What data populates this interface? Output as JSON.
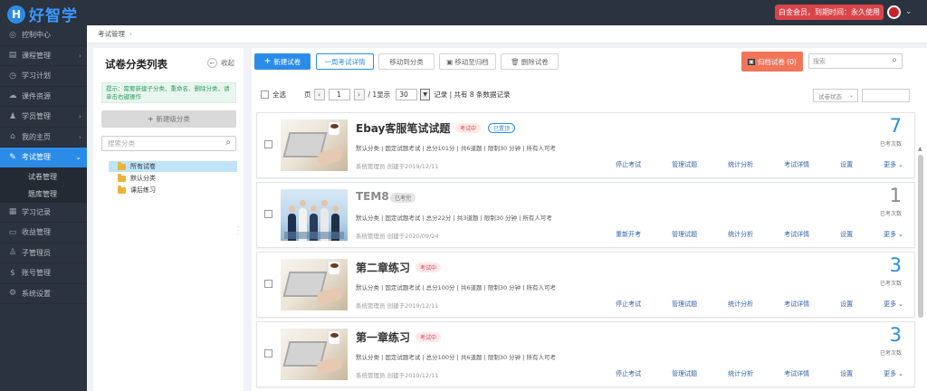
{
  "header": {
    "logo_letter": "H",
    "logo_text": "好智学",
    "vip_text": "白金会员，到期时间：永久使用"
  },
  "sidebar": {
    "items": [
      {
        "label": "控制中心",
        "icon": "dashboard-icon",
        "glyph": "◎"
      },
      {
        "label": "课程管理",
        "icon": "book-icon",
        "glyph": "▤",
        "chev": "›"
      },
      {
        "label": "学习计划",
        "icon": "plan-icon",
        "glyph": "◷"
      },
      {
        "label": "课件资源",
        "icon": "cloud-icon",
        "glyph": "☁"
      },
      {
        "label": "学员管理",
        "icon": "users-icon",
        "glyph": "♟",
        "chev": "›"
      },
      {
        "label": "我的主页",
        "icon": "home-icon",
        "glyph": "⌂",
        "chev": "›"
      },
      {
        "label": "考试管理",
        "icon": "exam-icon",
        "glyph": "✎",
        "chev": "⌄",
        "active": true
      }
    ],
    "sub_items": [
      "试卷管理",
      "题库管理"
    ],
    "items_after": [
      {
        "label": "学习记录",
        "icon": "record-icon",
        "glyph": "▦"
      },
      {
        "label": "收益管理",
        "icon": "wallet-icon",
        "glyph": "▭"
      },
      {
        "label": "子管理员",
        "icon": "admin-icon",
        "glyph": "♙"
      },
      {
        "label": "账号管理",
        "icon": "dollar-icon",
        "glyph": "$"
      },
      {
        "label": "系统设置",
        "icon": "settings-icon",
        "glyph": "⚙"
      }
    ]
  },
  "breadcrumb": {
    "current": "考试管理",
    "sep": "›"
  },
  "category_panel": {
    "title": "试卷分类列表",
    "collapse_label": "收起",
    "tip": "提示：需要新建子分类、重命名、删除分类，请单击右键操作",
    "new_category_label": "新建级分类",
    "search_placeholder": "搜索分类",
    "tree": [
      "所有试卷",
      "默认分类",
      "课后练习"
    ]
  },
  "toolbar": {
    "new_exam": "新建试卷",
    "exam_detail": "一周考试详情",
    "move_category": "移动到分类",
    "move_archive": "移动至归档",
    "delete_exam": "删除试卷",
    "archived": "归档试卷 (0)",
    "search_placeholder": "搜索"
  },
  "pager": {
    "select_all": "全选",
    "page_label": "页",
    "prev": "‹",
    "next": "›",
    "current_page": "1",
    "total_pages": "/ 1",
    "show_label": "显示",
    "per_page": "30",
    "records_label": "记录 | 共有 8 条数据记录"
  },
  "filter": {
    "status_placeholder": "试卷状态"
  },
  "exams": [
    {
      "title": "Ebay客服笔试试题",
      "status": "考试中",
      "top_tag": "已置顶",
      "meta": "默认分类 | 固定试题考试 | 总分101分 | 共6道题 | 限制30 分钟 | 所有人可考",
      "creator": "系统管理员   创建于2019/12/11",
      "count": "7",
      "count_label": "已考次数",
      "actions": [
        "停止考试",
        "管理试题",
        "统计分析",
        "考试详情",
        "设置",
        "更多"
      ]
    },
    {
      "title": "TEM8",
      "status": "已考完",
      "meta": "默认分类 | 固定试题考试 | 总分22分 | 共3道题 | 限制30 分钟 | 所有人可考",
      "creator": "系统管理员   创建于2020/09/24",
      "count": "1",
      "count_label": "已考次数",
      "actions": [
        "重新开考",
        "管理试题",
        "统计分析",
        "考试详情",
        "设置",
        "更多"
      ]
    },
    {
      "title": "第二章练习",
      "status": "考试中",
      "meta": "默认分类 | 固定试题考试 | 总分100分 | 共6道题 | 限制30 分钟 | 所有人可考",
      "creator": "系统管理员   创建于2019/12/11",
      "count": "3",
      "count_label": "已考次数",
      "actions": [
        "停止考试",
        "管理试题",
        "统计分析",
        "考试详情",
        "设置",
        "更多"
      ]
    },
    {
      "title": "第一章练习",
      "status": "考试中",
      "meta": "默认分类 | 固定试题考试 | 总分100分 | 共6道题 | 限制30 分钟 | 所有人可考",
      "creator": "系统管理员   创建于2019/12/11",
      "count": "3",
      "count_label": "已考次数",
      "actions": [
        "停止考试",
        "管理试题",
        "统计分析",
        "考试详情",
        "设置",
        "更多"
      ]
    }
  ],
  "colors": {
    "primary": "#2b8ce8",
    "sidebar": "#2b333e",
    "danger": "#e2424a",
    "archive": "#f07559"
  }
}
